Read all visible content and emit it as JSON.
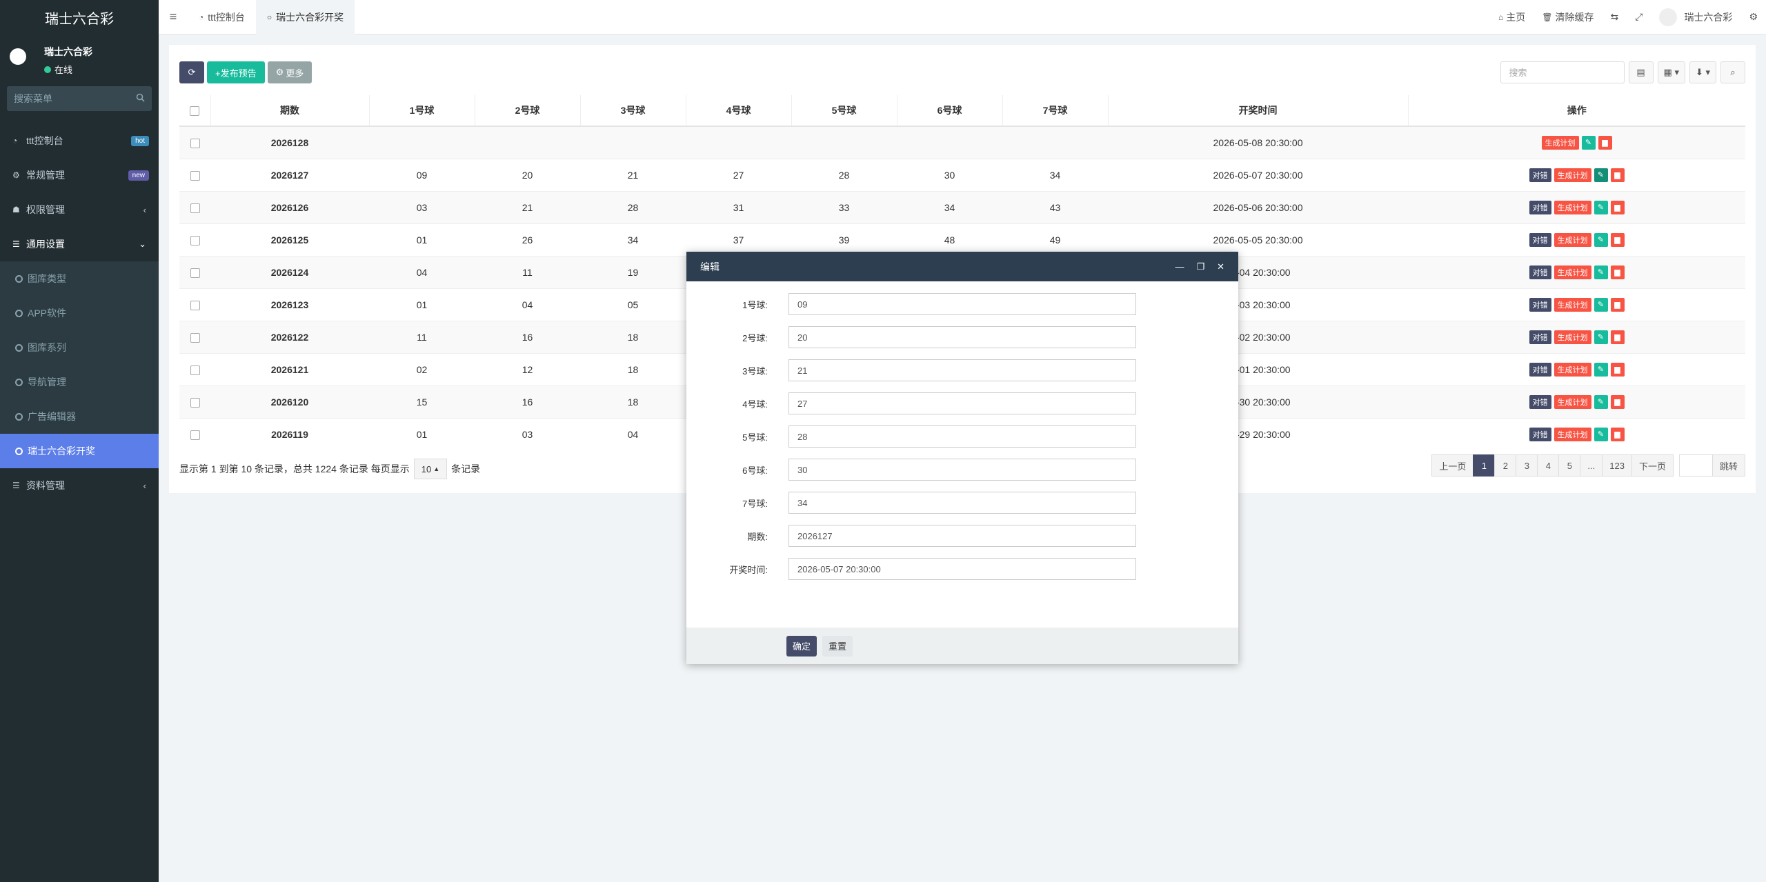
{
  "sidebar": {
    "brand": "瑞士六合彩",
    "user_name": "瑞士六合彩",
    "user_status": "在线",
    "search_placeholder": "搜索菜单",
    "menu": [
      {
        "label": "ttt控制台",
        "badge": "hot",
        "badge_color": "#3c8dbc"
      },
      {
        "label": "常规管理",
        "badge": "new",
        "badge_color": "#605ca8"
      },
      {
        "label": "权限管理",
        "arrow": "‹"
      },
      {
        "label": "通用设置",
        "arrow": "⌄"
      }
    ],
    "submenu": [
      "图库类型",
      "APP软件",
      "图库系列",
      "导航管理",
      "广告编辑器",
      "瑞士六合彩开奖"
    ],
    "bottom_menu": {
      "label": "资料管理",
      "arrow": "‹"
    }
  },
  "header": {
    "tabs": [
      "ttt控制台",
      "瑞士六合彩开奖"
    ],
    "home": "主页",
    "clear_cache": "清除缓存",
    "user": "瑞士六合彩"
  },
  "toolbar": {
    "publish": "+发布预告",
    "more": "更多",
    "search_placeholder": "搜索"
  },
  "table": {
    "headers": [
      "期数",
      "1号球",
      "2号球",
      "3号球",
      "4号球",
      "5号球",
      "6号球",
      "7号球",
      "开奖时间",
      "操作"
    ],
    "rows": [
      {
        "period": "2026128",
        "balls": [
          "",
          "",
          "",
          "",
          "",
          "",
          ""
        ],
        "time": "2026-05-08 20:30:00",
        "has_check": false
      },
      {
        "period": "2026127",
        "balls": [
          "09",
          "20",
          "21",
          "27",
          "28",
          "30",
          "34"
        ],
        "time": "2026-05-07 20:30:00",
        "has_check": true
      },
      {
        "period": "2026126",
        "balls": [
          "03",
          "21",
          "28",
          "31",
          "33",
          "34",
          "43"
        ],
        "time": "2026-05-06 20:30:00",
        "has_check": true
      },
      {
        "period": "2026125",
        "balls": [
          "01",
          "26",
          "34",
          "37",
          "39",
          "48",
          "49"
        ],
        "time": "2026-05-05 20:30:00",
        "has_check": true
      },
      {
        "period": "2026124",
        "balls": [
          "04",
          "11",
          "19",
          "",
          "",
          "",
          ""
        ],
        "time": "05-04 20:30:00",
        "has_check": true
      },
      {
        "period": "2026123",
        "balls": [
          "01",
          "04",
          "05",
          "",
          "",
          "",
          ""
        ],
        "time": "05-03 20:30:00",
        "has_check": true
      },
      {
        "period": "2026122",
        "balls": [
          "11",
          "16",
          "18",
          "",
          "",
          "",
          ""
        ],
        "time": "05-02 20:30:00",
        "has_check": true
      },
      {
        "period": "2026121",
        "balls": [
          "02",
          "12",
          "18",
          "",
          "",
          "",
          ""
        ],
        "time": "05-01 20:30:00",
        "has_check": true
      },
      {
        "period": "2026120",
        "balls": [
          "15",
          "16",
          "18",
          "",
          "",
          "",
          ""
        ],
        "time": "04-30 20:30:00",
        "has_check": true
      },
      {
        "period": "2026119",
        "balls": [
          "01",
          "03",
          "04",
          "",
          "",
          "",
          ""
        ],
        "time": "04-29 20:30:00",
        "has_check": true
      }
    ],
    "op_check": "对错",
    "op_plan": "生成计划"
  },
  "footer": {
    "info_prefix": "显示第 1 到第 10 条记录，总共 1224 条记录 每页显示",
    "page_size": "10",
    "info_suffix": "条记录",
    "prev": "上一页",
    "pages": [
      "1",
      "2",
      "3",
      "4",
      "5",
      "...",
      "123"
    ],
    "next": "下一页",
    "jump": "跳转"
  },
  "modal": {
    "title": "编辑",
    "fields": [
      {
        "label": "1号球:",
        "value": "09"
      },
      {
        "label": "2号球:",
        "value": "20"
      },
      {
        "label": "3号球:",
        "value": "21"
      },
      {
        "label": "4号球:",
        "value": "27"
      },
      {
        "label": "5号球:",
        "value": "28"
      },
      {
        "label": "6号球:",
        "value": "30"
      },
      {
        "label": "7号球:",
        "value": "34"
      },
      {
        "label": "期数:",
        "value": "2026127"
      },
      {
        "label": "开奖时间:",
        "value": "2026-05-07 20:30:00"
      }
    ],
    "confirm": "确定",
    "reset": "重置"
  }
}
